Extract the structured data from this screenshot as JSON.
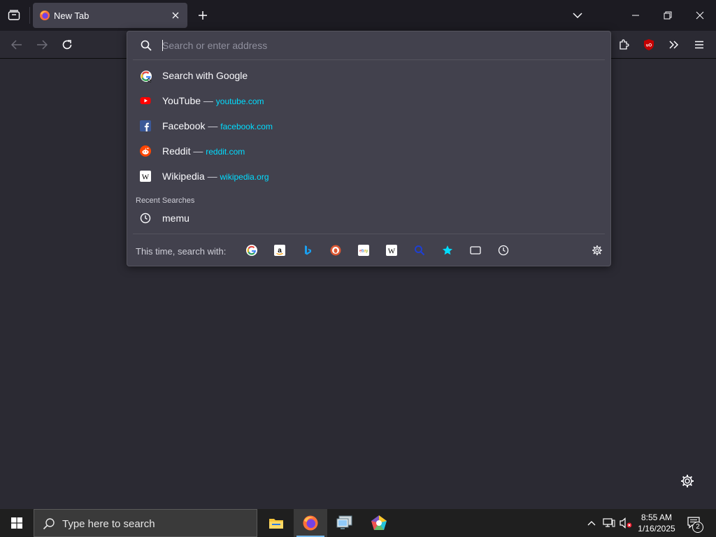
{
  "tabstrip": {
    "tab": {
      "title": "New Tab"
    },
    "icons": [
      "list-all-tabs-icon",
      "firefox-icon",
      "close-icon",
      "plus-icon",
      "chevron-down-icon",
      "minimize-icon",
      "restore-icon",
      "close-window-icon"
    ]
  },
  "navbar": {
    "icons": [
      "back-arrow-icon",
      "forward-arrow-icon",
      "reload-icon",
      "extensions-icon",
      "ublock-origin-icon",
      "overflow-chevron-icon",
      "hamburger-menu-icon"
    ]
  },
  "urlbar": {
    "placeholder": "Search or enter address",
    "first_result": {
      "label": "Search with Google",
      "icon": "google-icon"
    },
    "shortcuts": [
      {
        "name": "YouTube",
        "dash": "—",
        "url": "youtube.com",
        "icon": "youtube-icon"
      },
      {
        "name": "Facebook",
        "dash": "—",
        "url": "facebook.com",
        "icon": "facebook-icon"
      },
      {
        "name": "Reddit",
        "dash": "—",
        "url": "reddit.com",
        "icon": "reddit-icon"
      },
      {
        "name": "Wikipedia",
        "dash": "—",
        "url": "wikipedia.org",
        "icon": "wikipedia-icon"
      }
    ],
    "recent_label": "Recent Searches",
    "recent": [
      {
        "label": "memu",
        "icon": "history-clock-icon"
      }
    ],
    "oneoff_label": "This time, search with:",
    "oneoff_engines": [
      "google-icon",
      "amazon-icon",
      "bing-icon",
      "duckduckgo-icon",
      "ebay-icon",
      "wikipedia-icon",
      "search-shortcuts-icon",
      "bookmarks-star-icon",
      "tabs-icon",
      "history-icon"
    ],
    "settings_icon": "gear-icon"
  },
  "content": {
    "settings_icon": "gear-icon"
  },
  "taskbar": {
    "search_placeholder": "Type here to search",
    "apps": [
      "file-explorer-icon",
      "firefox-icon",
      "remote-desktop-icon",
      "app-pentagon-icon"
    ],
    "clock_time": "8:55 AM",
    "clock_date": "1/16/2025",
    "notification_count": "2",
    "tray_icons": [
      "show-hidden-icons-chevron",
      "network-icon",
      "volume-muted-icon",
      "notifications-icon"
    ]
  },
  "colors": {
    "accent_link": "#00ddff",
    "popup_bg": "#42414d",
    "toolbar_bg": "#2b2a33",
    "tabstrip_bg": "#1c1b22"
  }
}
